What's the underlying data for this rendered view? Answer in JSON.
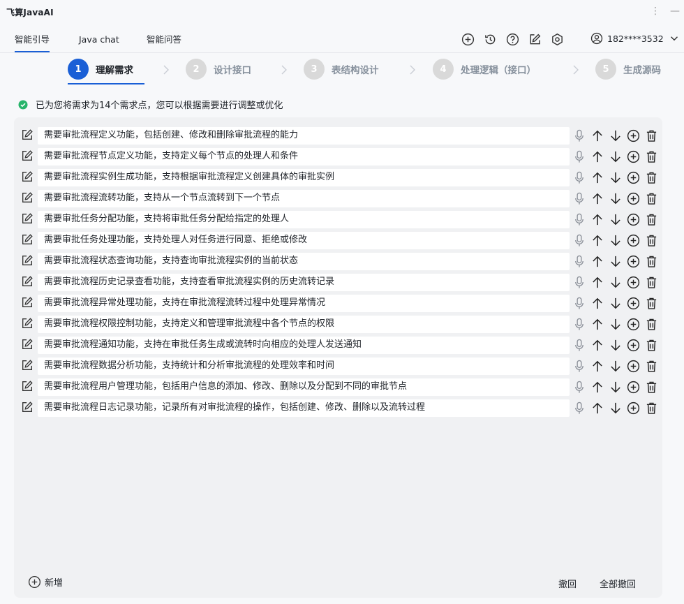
{
  "app": {
    "title": "飞算JavaAI"
  },
  "tabs": [
    {
      "label": "智能引导"
    },
    {
      "label": "Java chat"
    },
    {
      "label": "智能问答"
    }
  ],
  "account": {
    "phone": "182****3532"
  },
  "steps": [
    {
      "num": "1",
      "label": "理解需求"
    },
    {
      "num": "2",
      "label": "设计接口"
    },
    {
      "num": "3",
      "label": "表结构设计"
    },
    {
      "num": "4",
      "label": "处理逻辑（接口）"
    },
    {
      "num": "5",
      "label": "生成源码"
    }
  ],
  "notice": "已为您将需求为14个需求点，您可以根据需要进行调整或优化",
  "requirements": [
    "需要审批流程定义功能，包括创建、修改和删除审批流程的能力",
    "需要审批流程节点定义功能，支持定义每个节点的处理人和条件",
    "需要审批流程实例生成功能，支持根据审批流程定义创建具体的审批实例",
    "需要审批流程流转功能，支持从一个节点流转到下一个节点",
    "需要审批任务分配功能，支持将审批任务分配给指定的处理人",
    "需要审批任务处理功能，支持处理人对任务进行同意、拒绝或修改",
    "需要审批流程状态查询功能，支持查询审批流程实例的当前状态",
    "需要审批流程历史记录查看功能，支持查看审批流程实例的历史流转记录",
    "需要审批流程异常处理功能，支持在审批流程流转过程中处理异常情况",
    "需要审批流程权限控制功能，支持定义和管理审批流程中各个节点的权限",
    "需要审批流程通知功能，支持在审批任务生成或流转时向相应的处理人发送通知",
    "需要审批流程数据分析功能，支持统计和分析审批流程的处理效率和时间",
    "需要审批流程用户管理功能，包括用户信息的添加、修改、删除以及分配到不同的审批节点",
    "需要审批流程日志记录功能，记录所有对审批流程的操作，包括创建、修改、删除以及流转过程"
  ],
  "footer": {
    "add_label": "新增",
    "undo_label": "撤回",
    "undo_all_label": "全部撤回"
  },
  "colors": {
    "accent": "#1a5fd6",
    "success": "#27b46a",
    "panel": "#f0f1f3"
  },
  "icons": {
    "toolbar": [
      "plus-circle-icon",
      "history-icon",
      "help-icon",
      "edit-icon",
      "settings-icon"
    ],
    "row_actions": [
      "microphone-icon",
      "arrow-up-icon",
      "arrow-down-icon",
      "plus-circle-icon",
      "trash-icon"
    ]
  }
}
